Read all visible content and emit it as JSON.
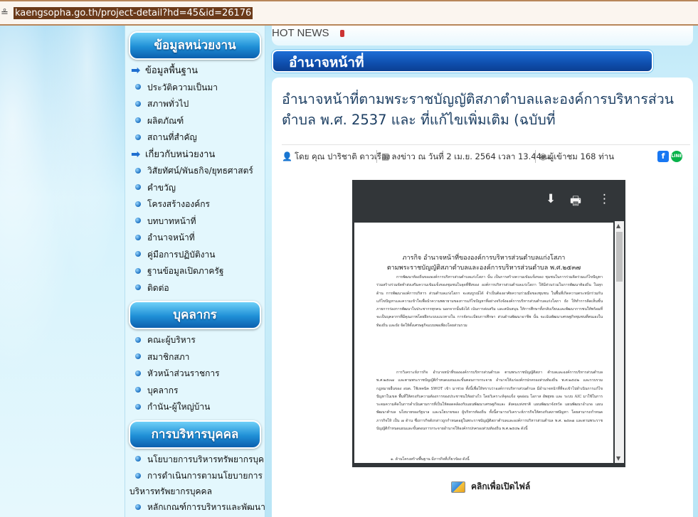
{
  "browser": {
    "url": "kaengsopha.go.th/project-detail?hd=45&id=26176",
    "lock_icon": "lock-icon"
  },
  "header": {
    "hot_news": "HOT NEWS",
    "section_title": "อำนาจหน้าที่"
  },
  "sidebar": {
    "section1": {
      "title": "ข้อมูลหน่วยงาน",
      "categories": [
        {
          "label": "ข้อมูลพื้นฐาน",
          "items": [
            "ประวัติความเป็นมา",
            "สภาพทั่วไป",
            "ผลิตภัณฑ์",
            "สถานที่สำคัญ"
          ]
        },
        {
          "label": "เกี่ยวกับหน่วยงาน",
          "items": [
            "วิสัยทัศน์/พันธกิจ/ยุทธศาสตร์",
            "คำขวัญ",
            "โครงสร้างองค์กร",
            "บทบาทหน้าที่",
            "อำนาจหน้าที่",
            "คู่มือการปฏิบัติงาน",
            "ฐานข้อมูลเปิดภาครัฐ",
            "ติดต่อ"
          ]
        }
      ]
    },
    "section2": {
      "title": "บุคลากร",
      "items": [
        "คณะผู้บริหาร",
        "สมาชิกสภา",
        "หัวหน้าส่วนราชการ",
        "บุคลากร",
        "กำนัน-ผู้ใหญ่บ้าน"
      ]
    },
    "section3": {
      "title": "การบริหารบุคคล",
      "items": [
        "นโยบายการบริหารทรัพยากรบุคคล"
      ],
      "wrapped_item": {
        "line1": "การดำเนินการตามนโยบายการ",
        "line2": "บริหารทรัพยากรบุคคล"
      },
      "last_item": "หลักเกณฑ์การบริหารและพัฒนา"
    }
  },
  "article": {
    "title": "อำนาจหน้าที่ตามพระราชบัญญัติสภาตำบลและองค์การบริหารส่วนตำบล พ.ศ. 2537 และ ที่แก้ไขเพิ่มเติม (ฉบับที่",
    "author": "โดย คุณ ปาริชาติ ดาวเรือง",
    "posted": "ลงข่าว ณ วันที่ 2 เม.ย. 2564 เวลา 13.44 น.",
    "views": "ผู้เข้าชม 168 ท่าน",
    "share_facebook": "f",
    "share_line": "LINE"
  },
  "pdf": {
    "toolbar": {
      "download": "download-icon",
      "print": "print-icon",
      "more": "more-vert-icon"
    },
    "doc_title_1": "ภารกิจ อำนาจหน้าที่ขององค์การบริหารส่วนตำบลแก่งโสภา",
    "doc_title_2": "ตามพระราชบัญญัติสภาตำบลและองค์การบริหารส่วนตำบล พ.ศ.๒๕๓๗",
    "para1": "การพัฒนาท้องถิ่นขององค์การบริหารส่วนตำบลแก่งโสภา นั้น เป็นการสร้างความเข้มแข็งของ ชุมชนในการร่วมคิดร่วมแก้ไขปัญหาร่วมสร้างร่วมจัดทำส่งเสริมความเข้มแข็งของชุมชนในจุดที่พึงของ องค์การบริหารส่วนตำบลแก่งโสภา ให้มีส่วนร่วมในการพัฒนาท้องถิ่น ในทุกด้าน การพัฒนาองค์การบริหาร ส่วนตำบลแก่งโสภา จะสมบูรณ์ได้ จำเป็นต้องอาศัยความร่วมมือของชุมชน ในพื้นที่เกิดความตระหนักร่วมกัน แก้ไขปัญหาและความเข้าใจเพื่อนำความพยายามของการแก้ไขปัญหาที่อย่างจริงจังองค์การบริหารส่วนตำบลแก่งโสภา ยัง ให้ทำการคิดเห็นชั้นภายการร่องการพัฒนาในประชากรทุกคน นอกจากนั้นยังได้ เน้นการส่งเสริม และสนับสนุน ให้การศึกษาทั้งกลับเรียนและพัฒนาการชนให้พร้อมที่จะเป็นบุคลากรที่มีคุณภาพโดยยึดระบบแนวทางใน การจัดระเบียบการศึกษา ส่วนด้านพัฒนาอาชีพ นั้น จะเน้นพัฒนาเศรษฐกิจชุมชนที่ตนเองในท้องถิ่น และยัง จัดให้ตั้งเศรษฐกิจแบบพอเพียงโดยส่วนรวม",
    "para2": "การวิเคราะห์ภารกิจ อำนาจหน้าที่ขององค์การบริหารส่วนตำบล ตามพระราชบัญญัติสภา ตำบลและองค์การบริหารส่วนตำบล พ.ศ.๒๕๓๗ และตามพระราชบัญญัติกำหนดแผนและขั้นตอนการกระจาย อำนาจให้แก่องค์กรปกครองส่วนท้องถิ่น พ.ศ.๒๕๔๒ และรวบรวมกฎหมายอื่นของ อบต. ใช้เทคนิค SWOT เข้า มาช่วย ทั้งนี้เพื่อให้ทราบว่าองค์การบริหารส่วนตำบล มีอำนาจหน้าที่ที่จะเข้าไปดำเนินการแก้ไขปัญหาในเขต พื้นที่ให้ตรงกับความต้องการของประชาชนให้อย่างไร โดยวิเคราะห์จุดแข็ง จุดอ่อน โอกาส อัพยุทธ และ ระบบ AIC มาใช้ในการระดมความคิดในการดำเนินตามการที่เป็นให้ตอดคล้องกับแผนพัฒนาเศรษฐกิจและ สังคมแห่งชาติ แผนพัฒนาจังหวัด แผนพัฒนาอำเภอ แผนพัฒนาตำบล นโยบายของรัฐบาล และนโยบายของ ผู้บริหารท้องถิ่น ทั้งนี้สามารถวิเคราะห์ภารกิจให้ตรงกับสภาพปัญหา โดยสามารถกำหนดภารกิจให้ เป็น ๗ ด้าน ซึ่งภารกิจดังกล่าวถูกกำหนดอยู่ในพระราชบัญญัติสภาตำบลและองค์การบริหารส่วนตำบล พ.ศ. ๒๕๓๗ และตามพระราชบัญญัติกำหนดแผนและขั้นตอนการกระจายอำนาจให้องค์กรปกครองส่วนท้องถิ่น พ.ศ.๒๕๔๒ ดังนี้",
    "para3": "๑. ด้านโครงสร้างพื้นฐาน มีภารกิจที่เกี่ยวข้อง ดังนี้"
  },
  "open_file": "คลิกเพื่อเปิดไฟล์"
}
